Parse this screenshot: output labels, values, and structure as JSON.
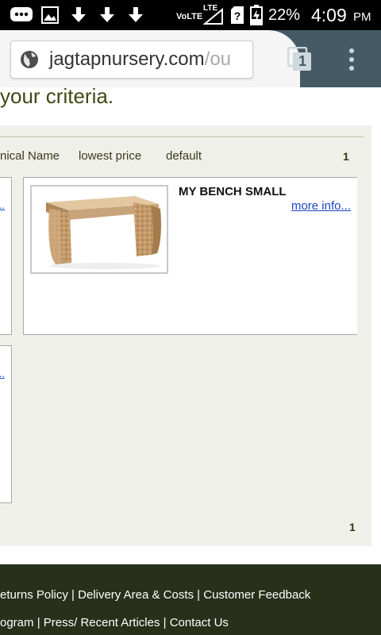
{
  "status_bar": {
    "network": "VoLTE",
    "lte": "LTE",
    "battery_percent": "22%",
    "time": "4:09",
    "ampm": "PM",
    "icons": [
      "bbm-icon",
      "image-icon",
      "download-icon",
      "download-icon",
      "download-icon",
      "signal-icon",
      "unknown-sim-icon",
      "battery-icon"
    ]
  },
  "browser": {
    "url_main": "jagtapnursery.com",
    "url_rest": "/ou",
    "tab_count": "1"
  },
  "page": {
    "heading": "your criteria.",
    "sort_options": [
      "nical Name",
      "lowest price",
      "default"
    ],
    "page_top": "1",
    "page_bottom": "1",
    "left_more_link": "...",
    "product": {
      "title": "MY BENCH SMALL",
      "more_link": "more info..."
    }
  },
  "footer": {
    "line1": [
      "eturns Policy",
      "Delivery Area & Costs",
      "Customer Feedback"
    ],
    "line2": [
      "ogram",
      "Press/ Recent Articles",
      "Contact Us"
    ],
    "separator": " | "
  }
}
